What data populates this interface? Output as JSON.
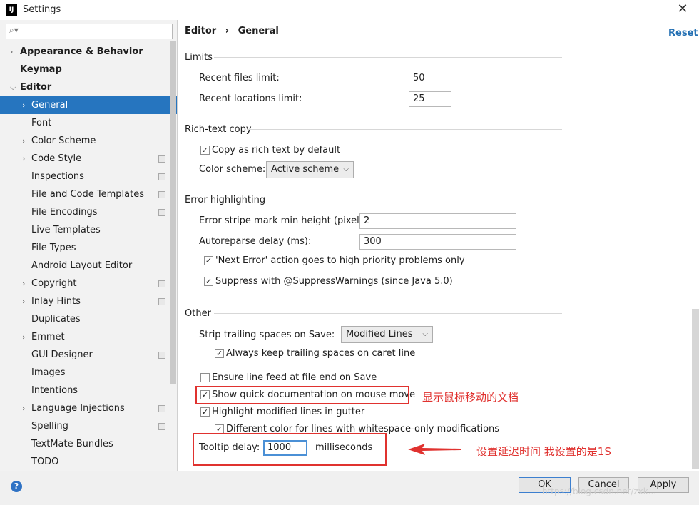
{
  "window": {
    "title": "Settings",
    "app_icon": "IJ"
  },
  "search": {
    "placeholder": ""
  },
  "tree": [
    {
      "label": "Appearance & Behavior",
      "bold": true,
      "chevron": "collapsed",
      "indent": 0,
      "proj": false
    },
    {
      "label": "Keymap",
      "bold": true,
      "chevron": "none",
      "indent": 0,
      "proj": false
    },
    {
      "label": "Editor",
      "bold": true,
      "chevron": "expanded",
      "indent": 0,
      "proj": false
    },
    {
      "label": "General",
      "bold": false,
      "chevron": "collapsed",
      "indent": 1,
      "proj": false,
      "selected": true
    },
    {
      "label": "Font",
      "bold": false,
      "chevron": "none",
      "indent": 1,
      "proj": false
    },
    {
      "label": "Color Scheme",
      "bold": false,
      "chevron": "collapsed",
      "indent": 1,
      "proj": false
    },
    {
      "label": "Code Style",
      "bold": false,
      "chevron": "collapsed",
      "indent": 1,
      "proj": true
    },
    {
      "label": "Inspections",
      "bold": false,
      "chevron": "none",
      "indent": 1,
      "proj": true
    },
    {
      "label": "File and Code Templates",
      "bold": false,
      "chevron": "none",
      "indent": 1,
      "proj": true
    },
    {
      "label": "File Encodings",
      "bold": false,
      "chevron": "none",
      "indent": 1,
      "proj": true
    },
    {
      "label": "Live Templates",
      "bold": false,
      "chevron": "none",
      "indent": 1,
      "proj": false
    },
    {
      "label": "File Types",
      "bold": false,
      "chevron": "none",
      "indent": 1,
      "proj": false
    },
    {
      "label": "Android Layout Editor",
      "bold": false,
      "chevron": "none",
      "indent": 1,
      "proj": false
    },
    {
      "label": "Copyright",
      "bold": false,
      "chevron": "collapsed",
      "indent": 1,
      "proj": true
    },
    {
      "label": "Inlay Hints",
      "bold": false,
      "chevron": "collapsed",
      "indent": 1,
      "proj": true
    },
    {
      "label": "Duplicates",
      "bold": false,
      "chevron": "none",
      "indent": 1,
      "proj": false
    },
    {
      "label": "Emmet",
      "bold": false,
      "chevron": "collapsed",
      "indent": 1,
      "proj": false
    },
    {
      "label": "GUI Designer",
      "bold": false,
      "chevron": "none",
      "indent": 1,
      "proj": true
    },
    {
      "label": "Images",
      "bold": false,
      "chevron": "none",
      "indent": 1,
      "proj": false
    },
    {
      "label": "Intentions",
      "bold": false,
      "chevron": "none",
      "indent": 1,
      "proj": false
    },
    {
      "label": "Language Injections",
      "bold": false,
      "chevron": "collapsed",
      "indent": 1,
      "proj": true
    },
    {
      "label": "Spelling",
      "bold": false,
      "chevron": "none",
      "indent": 1,
      "proj": true
    },
    {
      "label": "TextMate Bundles",
      "bold": false,
      "chevron": "none",
      "indent": 1,
      "proj": false
    },
    {
      "label": "TODO",
      "bold": false,
      "chevron": "none",
      "indent": 1,
      "proj": false
    }
  ],
  "breadcrumb": {
    "part1": "Editor",
    "sep": "›",
    "part2": "General"
  },
  "reset": "Reset",
  "limits": {
    "title": "Limits",
    "recent_files_label": "Recent files limit:",
    "recent_files_value": "50",
    "recent_locations_label": "Recent locations limit:",
    "recent_locations_value": "25"
  },
  "rich_text": {
    "title": "Rich-text copy",
    "copy_rich_label": "Copy as rich text by default",
    "copy_rich_checked": true,
    "color_scheme_label": "Color scheme:",
    "color_scheme_value": "Active scheme"
  },
  "error_highlighting": {
    "title": "Error highlighting",
    "stripe_label": "Error stripe mark min height (pixels):",
    "stripe_value": "2",
    "autoreparse_label": "Autoreparse delay (ms):",
    "autoreparse_value": "300",
    "next_error_label": "'Next Error' action goes to high priority problems only",
    "next_error_checked": true,
    "suppress_label": "Suppress with @SuppressWarnings (since Java 5.0)",
    "suppress_checked": true
  },
  "other": {
    "title": "Other",
    "strip_label": "Strip trailing spaces on Save:",
    "strip_value": "Modified Lines",
    "keep_trailing_label": "Always keep trailing spaces on caret line",
    "keep_trailing_checked": true,
    "line_feed_label": "Ensure line feed at file end on Save",
    "line_feed_checked": false,
    "quick_doc_label": "Show quick documentation on mouse move",
    "quick_doc_checked": true,
    "highlight_modified_label": "Highlight modified lines in gutter",
    "highlight_modified_checked": true,
    "diff_color_label": "Different color for lines with whitespace-only modifications",
    "diff_color_checked": true,
    "tooltip_label": "Tooltip delay:",
    "tooltip_value": "1000",
    "tooltip_unit": "milliseconds"
  },
  "annotations": {
    "quick_doc_note": "显示鼠标移动的文档",
    "tooltip_note": "设置延迟时间 我设置的是1S",
    "color": "#e0322f"
  },
  "footer": {
    "help": "?",
    "ok": "OK",
    "cancel": "Cancel",
    "apply": "Apply",
    "watermark": "https://blog.csdn.net/zxk..."
  }
}
